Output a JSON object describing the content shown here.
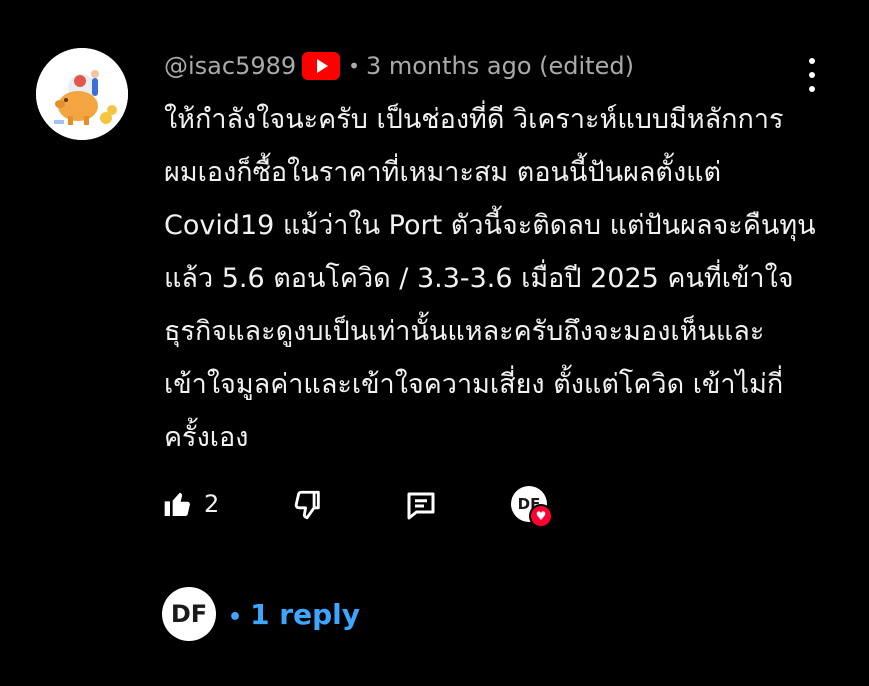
{
  "comment": {
    "handle": "@isac5989",
    "timestamp": "3 months ago (edited)",
    "text": "ให้กำลังใจนะครับ เป็นช่องที่ดี วิเคราะห์แบบมีหลักการ ผมเองก็ซื้อในราคาที่เหมาะสม ตอนนี้ปันผลตั้งแต่ Covid19 แม้ว่าใน Port ตัวนี้จะติดลบ แต่ปันผลจะคืนทุนแล้ว 5.6 ตอนโควิด / 3.3-3.6 เมื่อปี 2025 คนที่เข้าใจธุรกิจและดูงบเป็นเท่านั้นแหละครับถึงจะมองเห็นและเข้าใจมูลค่าและเข้าใจความเสี่ยง ตั้งแต่โควิด เข้าไม่กี่ครั้งเอง",
    "like_count": "2",
    "separator": "•"
  },
  "creator": {
    "initials": "DF"
  },
  "replies": {
    "label": "1 reply",
    "bullet": "•"
  },
  "icons": {
    "avatar": "piggy-bank-avatar",
    "badge": "youtube-play-icon",
    "menu": "more-vertical-icon",
    "like": "thumb-up-icon",
    "dislike": "thumb-down-icon",
    "reply": "comment-icon",
    "heart": "heart-icon"
  },
  "colors": {
    "background": "#000000",
    "link": "#3ea6ff",
    "badge": "#ff0000",
    "heart": "#ff0033"
  }
}
